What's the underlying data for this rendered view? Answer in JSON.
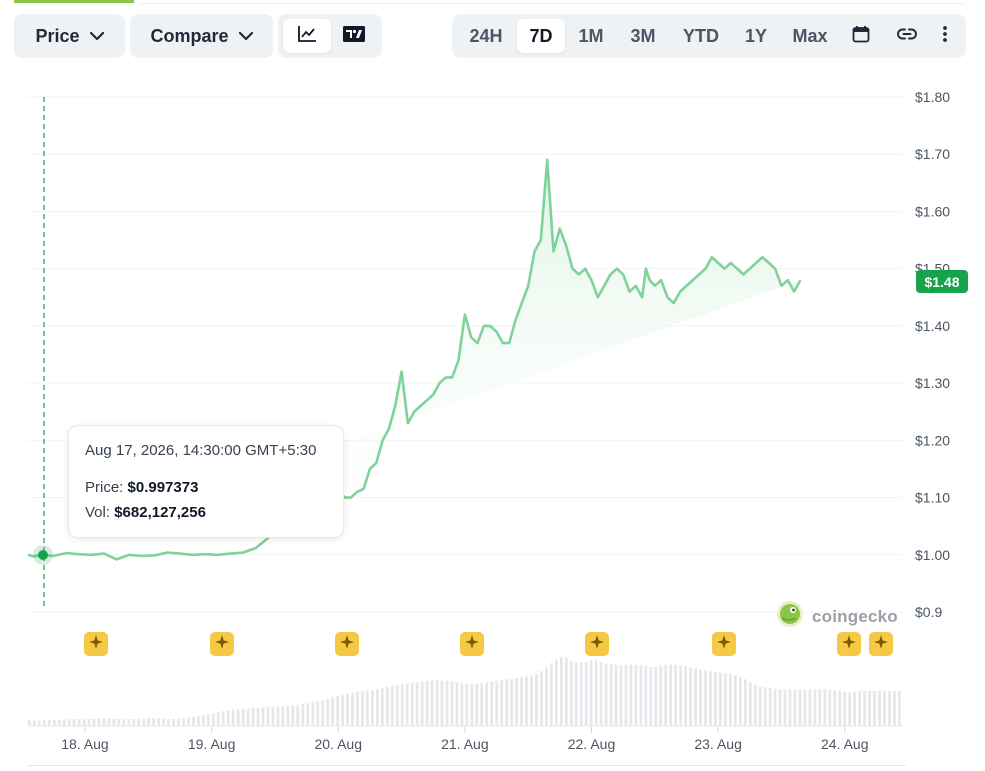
{
  "toolbar": {
    "price_label": "Price",
    "compare_label": "Compare",
    "ranges": [
      "24H",
      "7D",
      "1M",
      "3M",
      "YTD",
      "1Y",
      "Max"
    ],
    "active_range": "7D",
    "icons": [
      "line-chart-icon",
      "tradingview-icon",
      "calendar-icon",
      "link-icon",
      "more-vertical-icon"
    ]
  },
  "tooltip": {
    "date": "Aug 17, 2026, 14:30:00 GMT+5:30",
    "price_label": "Price:",
    "price_value": "$0.997373",
    "vol_label": "Vol:",
    "vol_value": "$682,127,256"
  },
  "current_price": "$1.48",
  "watermark": "coingecko",
  "colors": {
    "line": "#7fd39a",
    "fill_top": "#dff3e4",
    "accent_green": "#16a34a",
    "volume": "#e5e7eb",
    "event_marker": "#f6c945"
  },
  "chart_data": {
    "type": "area",
    "x_tick_labels": [
      "18. Aug",
      "19. Aug",
      "20. Aug",
      "21. Aug",
      "22. Aug",
      "23. Aug",
      "24. Aug"
    ],
    "y_tick_labels": [
      "$1.80",
      "$1.70",
      "$1.60",
      "$1.50",
      "$1.40",
      "$1.30",
      "$1.20",
      "$1.10",
      "$1.00",
      "$0.9"
    ],
    "ylim": [
      0.9,
      1.8
    ],
    "xlim_days": [
      17.55,
      24.46
    ],
    "grid": "horizontal",
    "series": [
      {
        "x_days": [
          17.55,
          17.6,
          17.65,
          17.75,
          17.85,
          17.95,
          18.05,
          18.15,
          18.25,
          18.35,
          18.45,
          18.55,
          18.65,
          18.75,
          18.85,
          18.95,
          19.05,
          19.15,
          19.25,
          19.35,
          19.45,
          19.55,
          19.65,
          19.75,
          19.85,
          19.95,
          20.0,
          20.05,
          20.1,
          20.15,
          20.2,
          20.25,
          20.3,
          20.35,
          20.4,
          20.45,
          20.5,
          20.55,
          20.6,
          20.65,
          20.7,
          20.75,
          20.8,
          20.85,
          20.9,
          20.95,
          21.0,
          21.05,
          21.1,
          21.15,
          21.2,
          21.25,
          21.3,
          21.35,
          21.4,
          21.45,
          21.5,
          21.55,
          21.6,
          21.65,
          21.7,
          21.75,
          21.8,
          21.85,
          21.9,
          21.95,
          22.0,
          22.05,
          22.1,
          22.15,
          22.2,
          22.25,
          22.3,
          22.35,
          22.4,
          22.43,
          22.46,
          22.5,
          22.55,
          22.6,
          22.65,
          22.7,
          22.75,
          22.8,
          22.85,
          22.9,
          22.95,
          23.0,
          23.05,
          23.1,
          23.15,
          23.2,
          23.25,
          23.3,
          23.35,
          23.4,
          23.45,
          23.5,
          23.55,
          23.6,
          23.65,
          23.7,
          23.75,
          23.8,
          23.85,
          23.9,
          23.95,
          24.0,
          24.05,
          24.1,
          24.15,
          24.2,
          24.25,
          24.3,
          24.35,
          24.4,
          24.46
        ],
        "y": [
          1.0,
          0.997,
          1.0,
          0.998,
          1.003,
          1.001,
          1.0,
          1.002,
          0.992,
          1.0,
          0.998,
          0.999,
          1.004,
          1.002,
          1.0,
          1.001,
          1.0,
          1.002,
          1.004,
          1.012,
          1.03,
          1.07,
          1.085,
          1.13,
          1.1,
          1.11,
          1.115,
          1.1,
          1.1,
          1.11,
          1.115,
          1.15,
          1.16,
          1.2,
          1.22,
          1.26,
          1.32,
          1.23,
          1.25,
          1.26,
          1.27,
          1.28,
          1.3,
          1.31,
          1.31,
          1.34,
          1.42,
          1.38,
          1.37,
          1.4,
          1.4,
          1.39,
          1.37,
          1.37,
          1.41,
          1.44,
          1.47,
          1.53,
          1.55,
          1.69,
          1.53,
          1.57,
          1.54,
          1.5,
          1.49,
          1.5,
          1.48,
          1.45,
          1.47,
          1.49,
          1.5,
          1.49,
          1.46,
          1.47,
          1.45,
          1.5,
          1.48,
          1.47,
          1.48,
          1.45,
          1.44,
          1.46,
          1.47,
          1.48,
          1.49,
          1.5,
          1.52,
          1.51,
          1.5,
          1.51,
          1.5,
          1.49,
          1.5,
          1.51,
          1.52,
          1.51,
          1.5,
          1.47,
          1.48,
          1.46,
          1.48
        ]
      }
    ],
    "volume_min": 0,
    "volume_relative": [
      0.08,
      0.08,
      0.09,
      0.09,
      0.1,
      0.1,
      0.1,
      0.11,
      0.11,
      0.1,
      0.1,
      0.1,
      0.11,
      0.11,
      0.1,
      0.1,
      0.12,
      0.14,
      0.16,
      0.2,
      0.22,
      0.24,
      0.25,
      0.26,
      0.27,
      0.28,
      0.28,
      0.3,
      0.32,
      0.35,
      0.38,
      0.42,
      0.45,
      0.48,
      0.5,
      0.52,
      0.55,
      0.58,
      0.6,
      0.62,
      0.64,
      0.66,
      0.65,
      0.63,
      0.6,
      0.6,
      0.62,
      0.64,
      0.66,
      0.68,
      0.7,
      0.72,
      0.8,
      0.92,
      1.0,
      0.92,
      0.9,
      0.95,
      0.9,
      0.88,
      0.86,
      0.88,
      0.86,
      0.84,
      0.86,
      0.88,
      0.86,
      0.84,
      0.8,
      0.78,
      0.76,
      0.74,
      0.7,
      0.62,
      0.56,
      0.54,
      0.52,
      0.52,
      0.52,
      0.52,
      0.52,
      0.52,
      0.5,
      0.48,
      0.5,
      0.5,
      0.5,
      0.5,
      0.5
    ]
  }
}
